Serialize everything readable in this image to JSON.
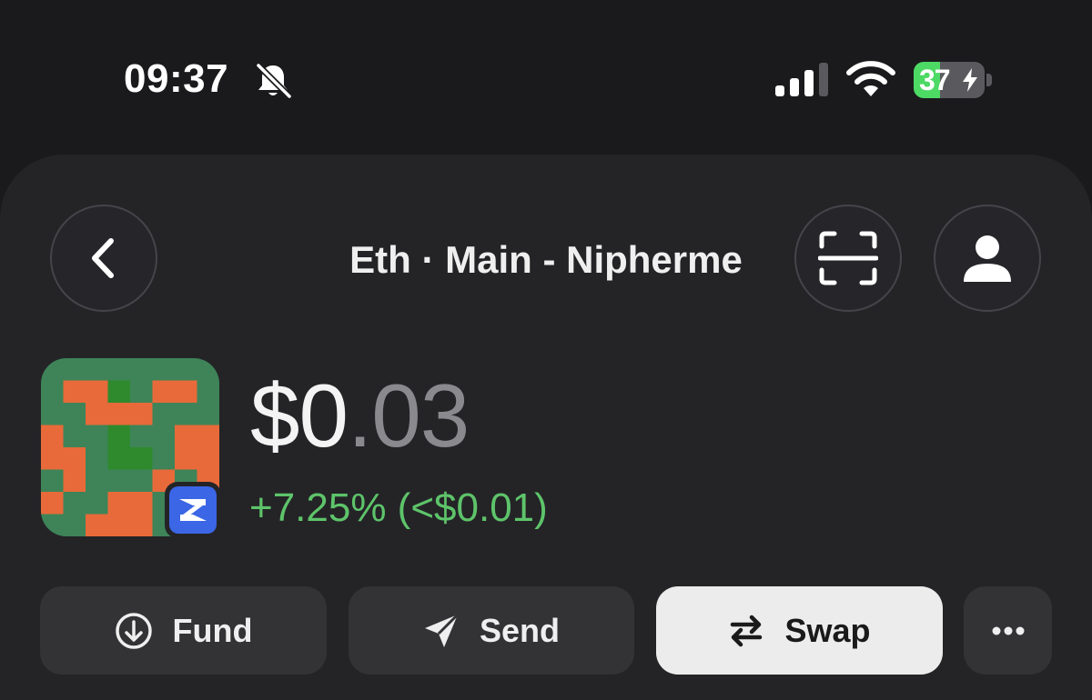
{
  "status_bar": {
    "time": "09:37",
    "battery_level": "37",
    "battery_fraction": 0.37,
    "silent_mode_icon": "bell-slash-icon",
    "signal_icon": "cellular-signal-icon",
    "wifi_icon": "wifi-icon",
    "battery_color": "#4cd964"
  },
  "header": {
    "title": "Eth · Main - Nipherme",
    "back_icon": "chevron-left-icon",
    "scan_icon": "qr-scan-icon",
    "profile_icon": "person-icon"
  },
  "wallet": {
    "balance_main": "$0",
    "balance_decimals": ".03",
    "change": "+7.25% (<$0.01)",
    "change_color": "#5ec46a",
    "avatar_icon": "wallet-identicon",
    "chain_badge_icon": "zksync-chain-icon"
  },
  "actions": {
    "fund_label": "Fund",
    "send_label": "Send",
    "swap_label": "Swap",
    "more_icon": "ellipsis-icon"
  }
}
